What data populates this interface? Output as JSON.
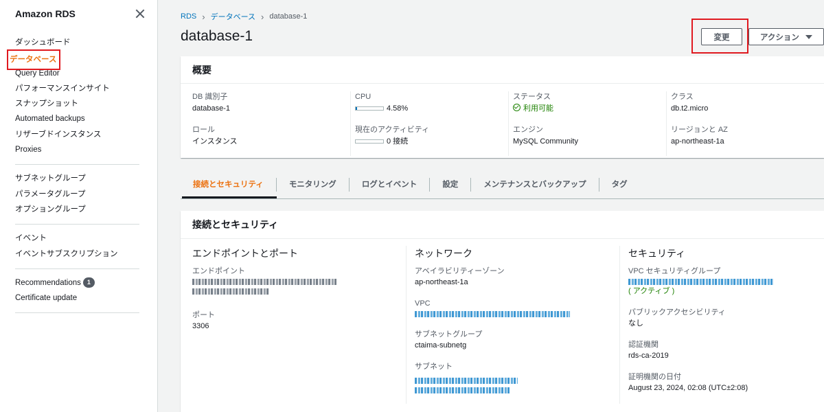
{
  "sidebar": {
    "title": "Amazon RDS",
    "groups": [
      [
        "ダッシュボード",
        "データベース",
        "Query Editor",
        "パフォーマンスインサイト",
        "スナップショット",
        "Automated backups",
        "リザーブドインスタンス",
        "Proxies"
      ],
      [
        "サブネットグループ",
        "パラメータグループ",
        "オプショングループ"
      ],
      [
        "イベント",
        "イベントサブスクリプション"
      ],
      [
        "Recommendations",
        "Certificate update"
      ]
    ],
    "recommendations_badge": "1"
  },
  "breadcrumb": {
    "root": "RDS",
    "section": "データベース",
    "current": "database-1"
  },
  "page_title": "database-1",
  "actions": {
    "modify": "変更",
    "action": "アクション"
  },
  "summary": {
    "title": "概要",
    "cols": [
      {
        "l1": "DB 識別子",
        "v1": "database-1",
        "l2": "ロール",
        "v2": "インスタンス"
      },
      {
        "l1": "CPU",
        "v1": "4.58%",
        "l2": "現在のアクティビティ",
        "v2": "0 接続"
      },
      {
        "l1": "ステータス",
        "v1": "利用可能",
        "l2": "エンジン",
        "v2": "MySQL Community"
      },
      {
        "l1": "クラス",
        "v1": "db.t2.micro",
        "l2": "リージョンと AZ",
        "v2": "ap-northeast-1a"
      }
    ],
    "cpu_percent": 4.58
  },
  "tabs": [
    "接続とセキュリティ",
    "モニタリング",
    "ログとイベント",
    "設定",
    "メンテナンスとバックアップ",
    "タグ"
  ],
  "conn": {
    "title": "接続とセキュリティ",
    "endpoint": {
      "title": "エンドポイントとポート",
      "endpoint_label": "エンドポイント",
      "port_label": "ポート",
      "port": "3306"
    },
    "network": {
      "title": "ネットワーク",
      "az_label": "アベイラビリティーゾーン",
      "az": "ap-northeast-1a",
      "vpc_label": "VPC",
      "subnet_group_label": "サブネットグループ",
      "subnet_group": "ctaima-subnetg",
      "subnet_label": "サブネット"
    },
    "security": {
      "title": "セキュリティ",
      "sg_label": "VPC セキュリティグループ",
      "sg_status": "( アクティブ )",
      "public_label": "パブリックアクセシビリティ",
      "public": "なし",
      "ca_label": "認証機関",
      "ca": "rds-ca-2019",
      "ca_date_label": "証明機関の日付",
      "ca_date": "August 23, 2024, 02:08 (UTC±2:08)"
    }
  },
  "colors": {
    "accent": "#ec7211",
    "link": "#0073bb",
    "success": "#1d8102",
    "highlight": "#e0191f"
  }
}
